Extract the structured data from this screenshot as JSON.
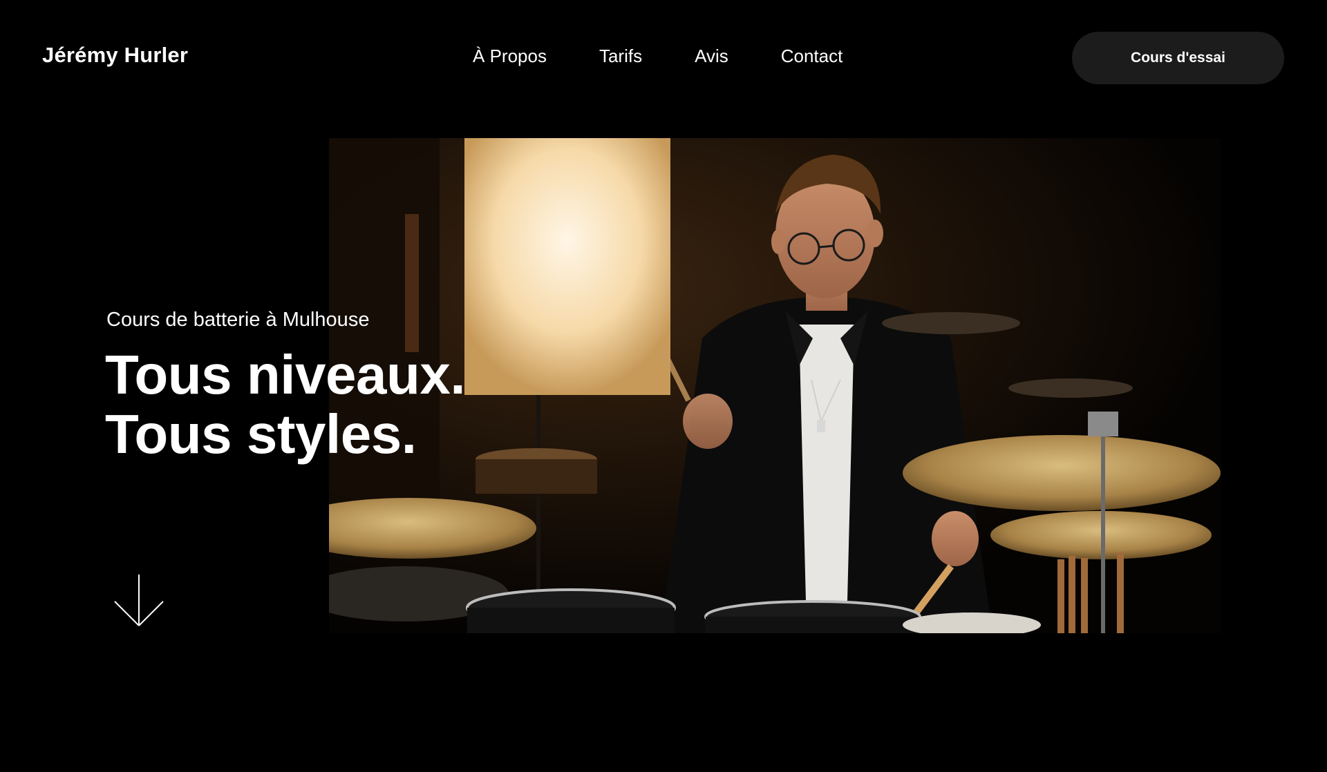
{
  "header": {
    "brand": "Jérémy Hurler",
    "nav": [
      {
        "label": "À Propos"
      },
      {
        "label": "Tarifs"
      },
      {
        "label": "Avis"
      },
      {
        "label": "Contact"
      }
    ],
    "cta_label": "Cours d'essai"
  },
  "hero": {
    "subtitle": "Cours de batterie à Mulhouse",
    "headline_line1": "Tous niveaux.",
    "headline_line2": "Tous styles.",
    "scroll_icon": "arrow-down-icon"
  },
  "colors": {
    "background": "#000000",
    "text": "#ffffff",
    "cta_background": "#1c1c1c"
  }
}
